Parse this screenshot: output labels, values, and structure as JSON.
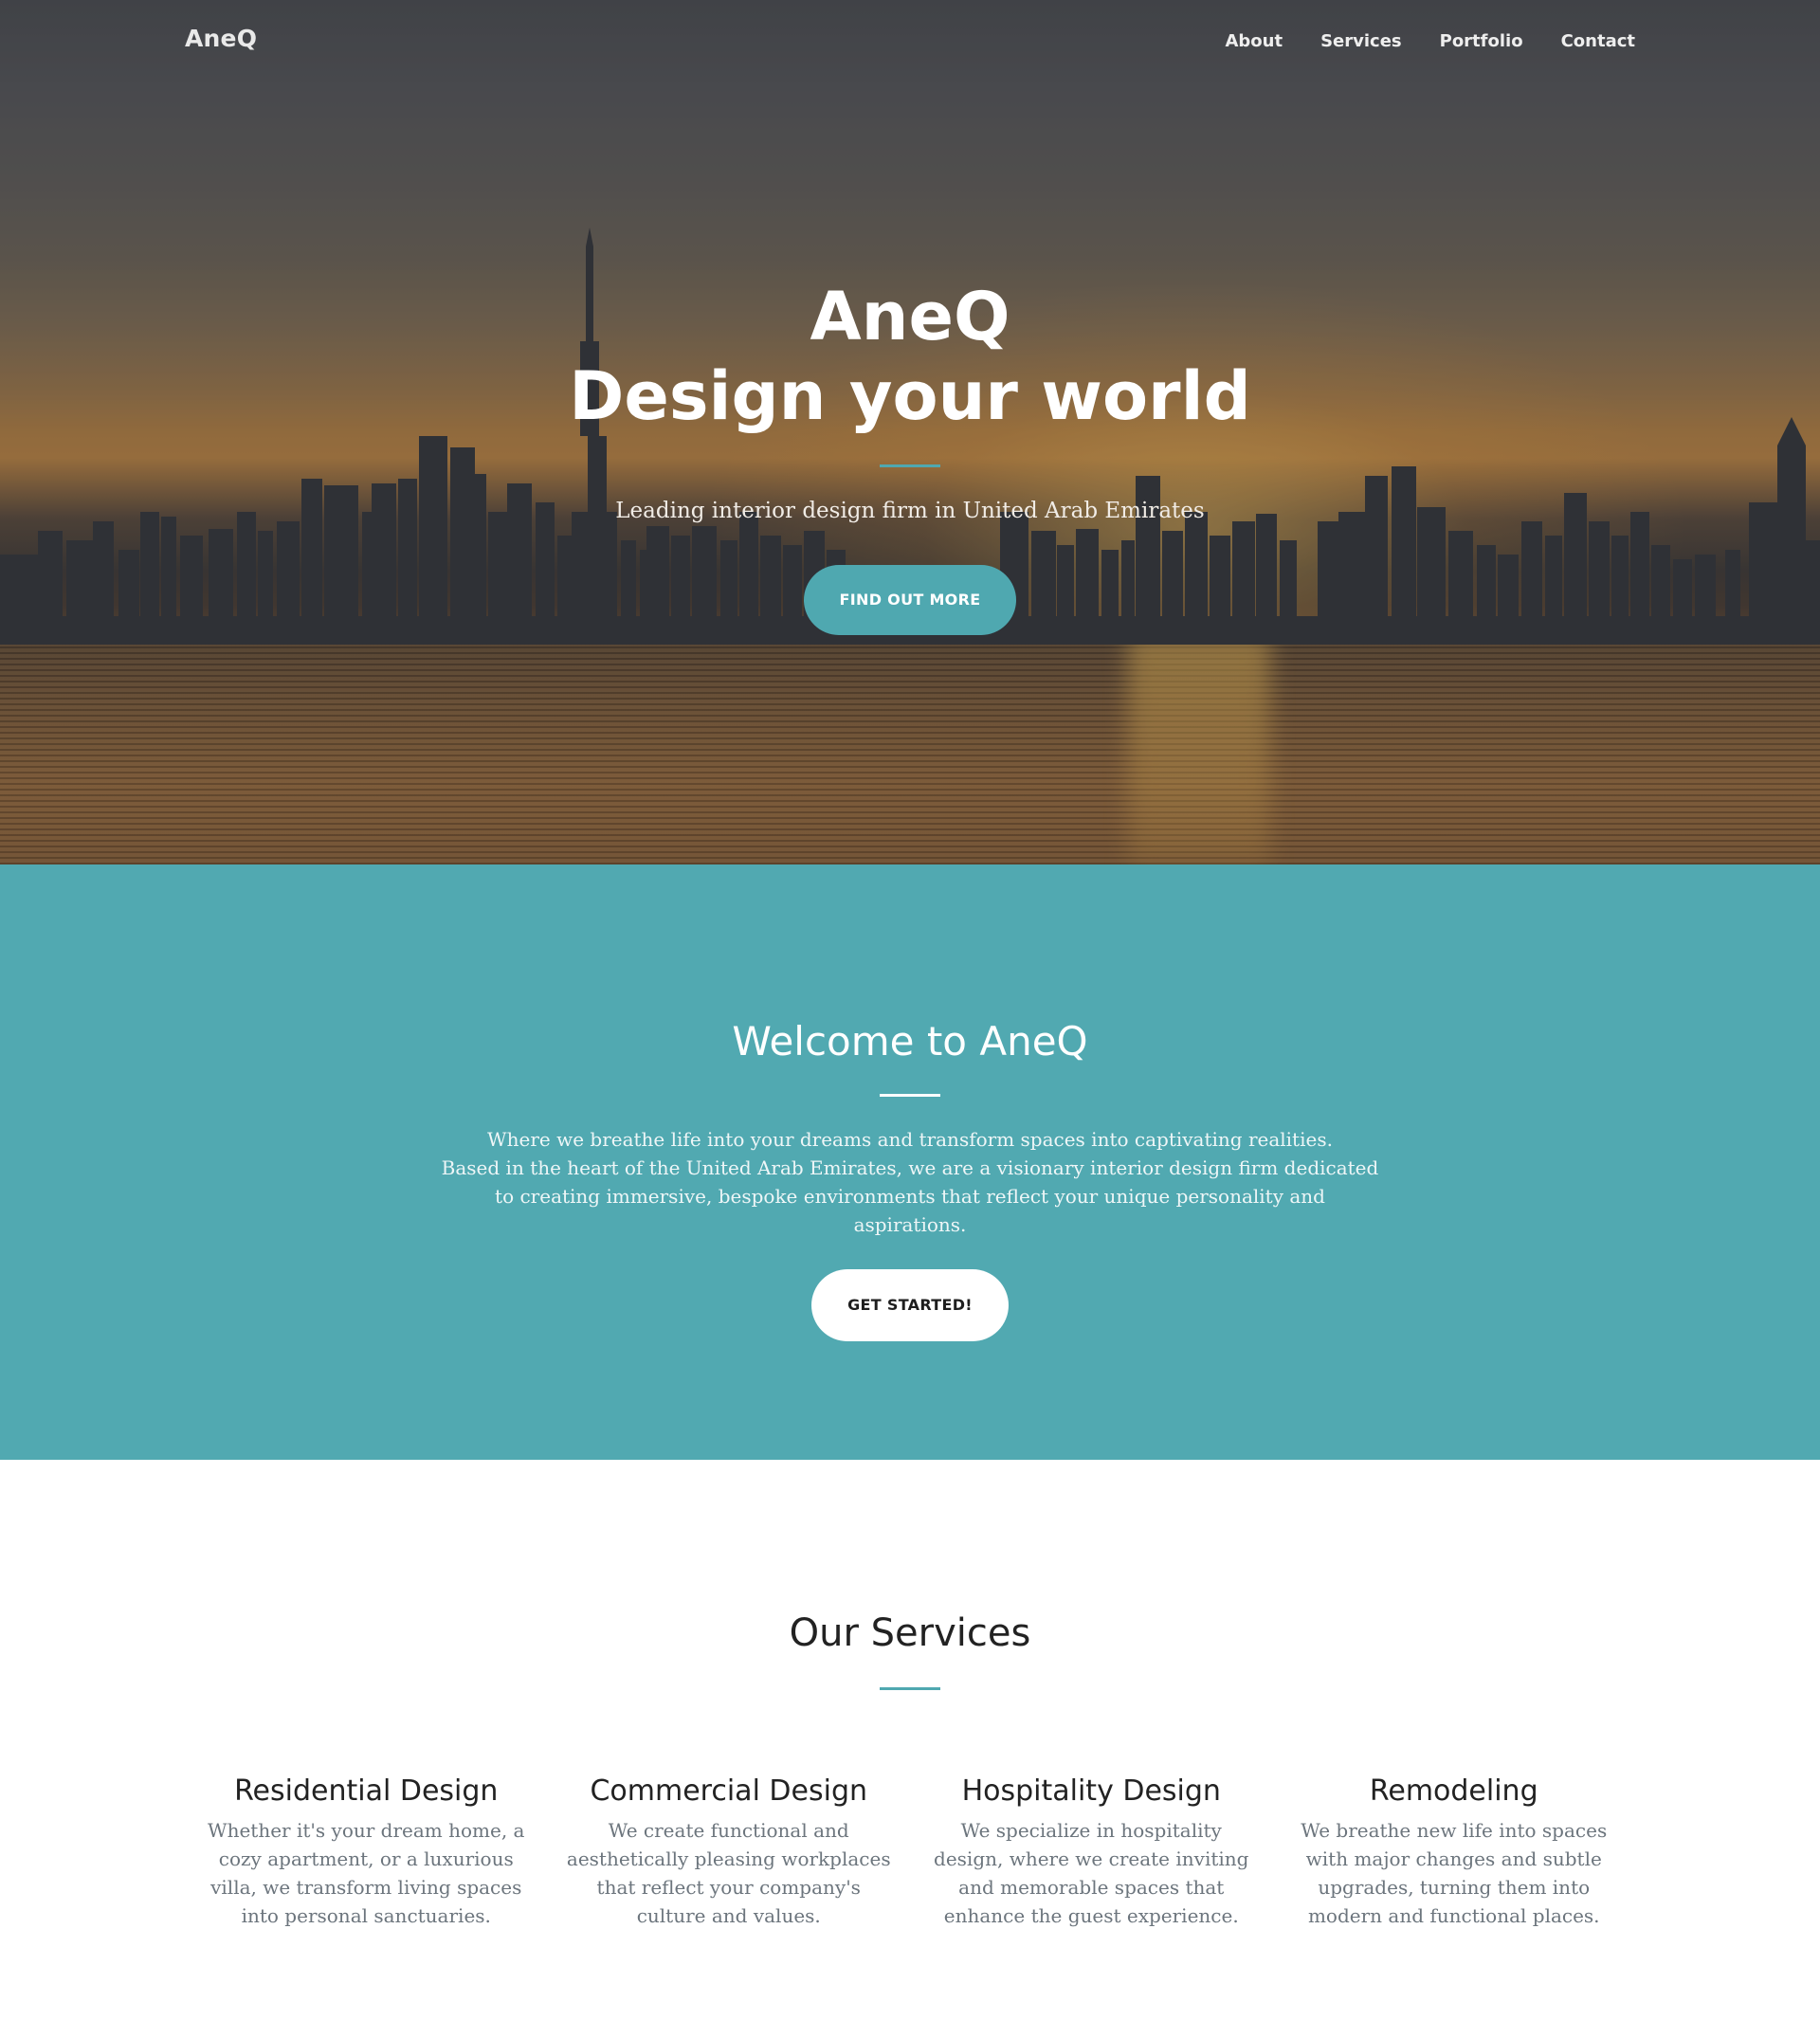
{
  "nav": {
    "brand": "AneQ",
    "links": [
      "About",
      "Services",
      "Portfolio",
      "Contact"
    ]
  },
  "hero": {
    "title_line1": "AneQ",
    "title_line2": "Design your world",
    "subtitle": "Leading interior design firm in United Arab Emirates",
    "button_label": "FIND OUT MORE"
  },
  "welcome": {
    "title": "Welcome to AneQ",
    "text_line1": "Where we breathe life into your dreams and transform spaces into captivating realities.",
    "text_line2": "Based in the heart of the United Arab Emirates, we are a visionary interior design firm dedicated to creating immersive, bespoke environments that reflect your unique personality and aspirations.",
    "button_label": "GET STARTED!"
  },
  "services": {
    "title": "Our Services",
    "items": [
      {
        "title": "Residential Design",
        "text": "Whether it's your dream home, a cozy apartment, or a luxurious villa, we transform living spaces into personal sanctuaries."
      },
      {
        "title": "Commercial Design",
        "text": "We create functional and aesthetically pleasing workplaces that reflect your company's culture and values."
      },
      {
        "title": "Hospitality Design",
        "text": "We specialize in hospitality design, where we create inviting and memorable spaces that enhance the guest experience."
      },
      {
        "title": "Remodeling",
        "text": "We breathe new life into spaces with major changes and subtle upgrades, turning them into modern and functional places."
      }
    ]
  },
  "colors": {
    "accent": "#4fa8b0",
    "welcome_background": "#51a9b1",
    "heading_text": "#222222",
    "muted_text": "#6c757d"
  }
}
